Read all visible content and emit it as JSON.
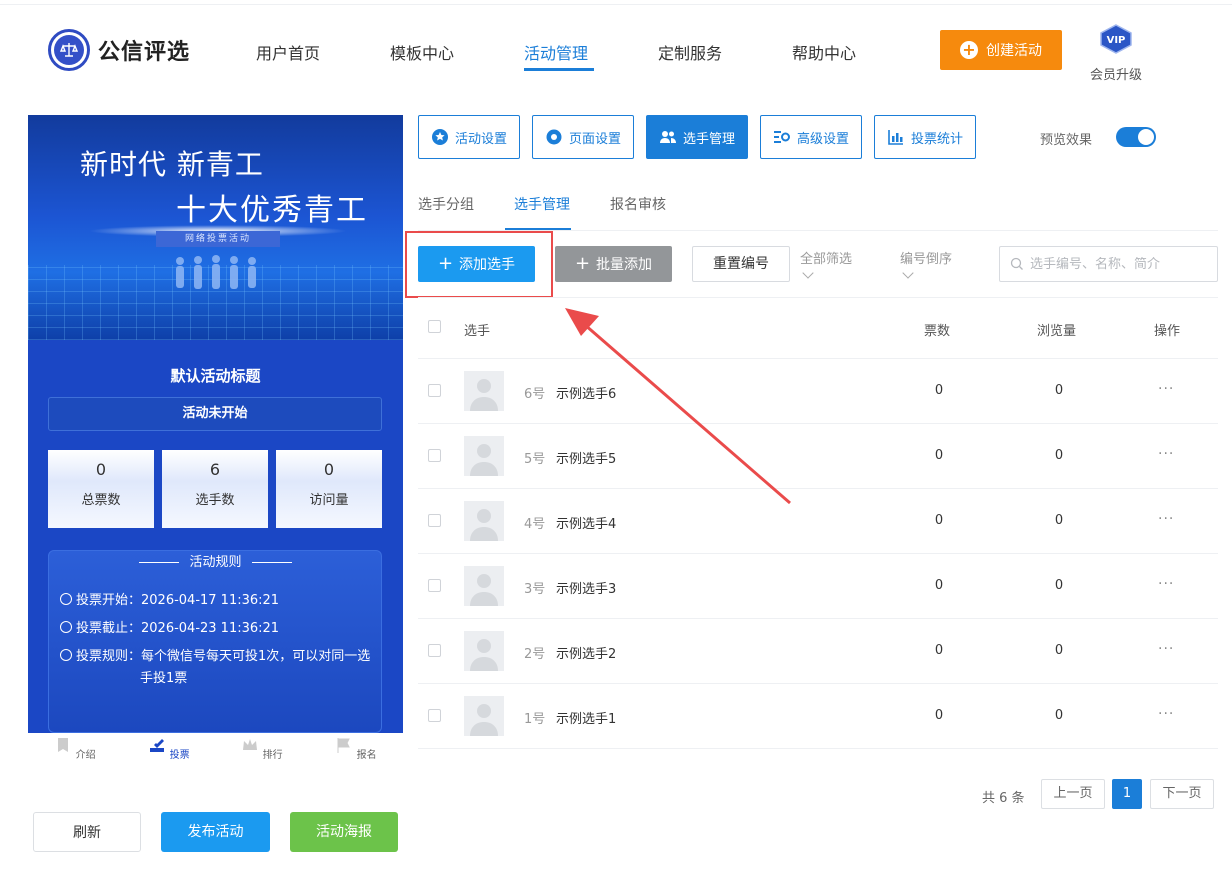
{
  "brand": {
    "name": "公信评选"
  },
  "nav": [
    "用户首页",
    "模板中心",
    "活动管理",
    "定制服务",
    "帮助中心"
  ],
  "header": {
    "create_label": "创建活动",
    "vip_badge": "VIP",
    "vip_label": "会员升级"
  },
  "phone": {
    "banner_line1": "新时代 新青工",
    "banner_line2": "十大优秀青工",
    "banner_sub": "网络投票活动",
    "activity_title": "默认活动标题",
    "activity_status": "活动未开始",
    "stats": [
      {
        "value": "0",
        "label": "总票数"
      },
      {
        "value": "6",
        "label": "选手数"
      },
      {
        "value": "0",
        "label": "访问量"
      }
    ],
    "rules_title": "活动规则",
    "rules": [
      "投票开始：2026-04-17 11:36:21",
      "投票截止：2026-04-23 11:36:21",
      "投票规则：每个微信号每天可投1次，可以对同一选",
      "手投1票"
    ],
    "tabs": [
      "介绍",
      "投票",
      "排行",
      "报名"
    ]
  },
  "bottom_buttons": {
    "refresh": "刷新",
    "publish": "发布活动",
    "poster": "活动海报"
  },
  "toolbar": [
    "活动设置",
    "页面设置",
    "选手管理",
    "高级设置",
    "投票统计"
  ],
  "preview_label": "预览效果",
  "preview_on": true,
  "subtabs": [
    "选手分组",
    "选手管理",
    "报名审核"
  ],
  "actions": {
    "add": "添加选手",
    "batch": "批量添加",
    "reset": "重置编号",
    "filter": "全部筛选",
    "order": "编号倒序",
    "search_placeholder": "选手编号、名称、简介"
  },
  "table": {
    "headers": [
      "选手",
      "票数",
      "浏览量",
      "操作"
    ],
    "rows": [
      {
        "num": "6号",
        "name": "示例选手6",
        "votes": "0",
        "views": "0",
        "more": "···"
      },
      {
        "num": "5号",
        "name": "示例选手5",
        "votes": "0",
        "views": "0",
        "more": "···"
      },
      {
        "num": "4号",
        "name": "示例选手4",
        "votes": "0",
        "views": "0",
        "more": "···"
      },
      {
        "num": "3号",
        "name": "示例选手3",
        "votes": "0",
        "views": "0",
        "more": "···"
      },
      {
        "num": "2号",
        "name": "示例选手2",
        "votes": "0",
        "views": "0",
        "more": "···"
      },
      {
        "num": "1号",
        "name": "示例选手1",
        "votes": "0",
        "views": "0",
        "more": "···"
      }
    ]
  },
  "pagination": {
    "total": "共 6 条",
    "prev": "上一页",
    "current": "1",
    "next": "下一页"
  },
  "colors": {
    "primary": "#1b7ed8",
    "orange": "#f68a0d",
    "green": "#6cc34a",
    "annotation": "#ea4b4b",
    "phone_bg": "#1b47c5"
  }
}
